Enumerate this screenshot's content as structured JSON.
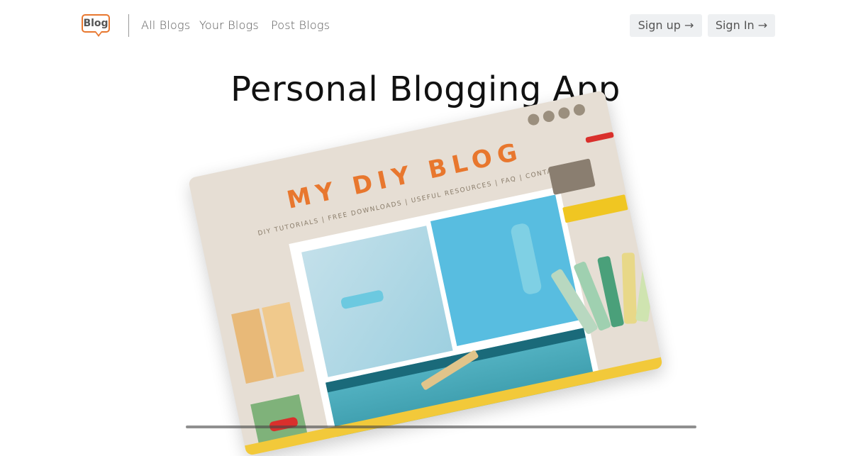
{
  "nav": {
    "logo_text": "Blog",
    "links": [
      "All Blogs",
      "Your Blogs",
      "Post Blogs"
    ],
    "signup_label": "Sign up →",
    "signin_label": "Sign In →"
  },
  "hero": {
    "title": "Personal Blogging App",
    "image": {
      "heading": "MY DIY BLOG",
      "menu": "DIY TUTORIALS | FREE DOWNLOADS | USEFUL RESOURCES | FAQ | CONTACT",
      "social_icons": [
        "google-plus-icon",
        "facebook-icon",
        "twitter-icon",
        "instagram-icon"
      ]
    }
  },
  "colors": {
    "accent": "#e8772e",
    "button_bg": "#eef0f2",
    "title": "#111111"
  }
}
